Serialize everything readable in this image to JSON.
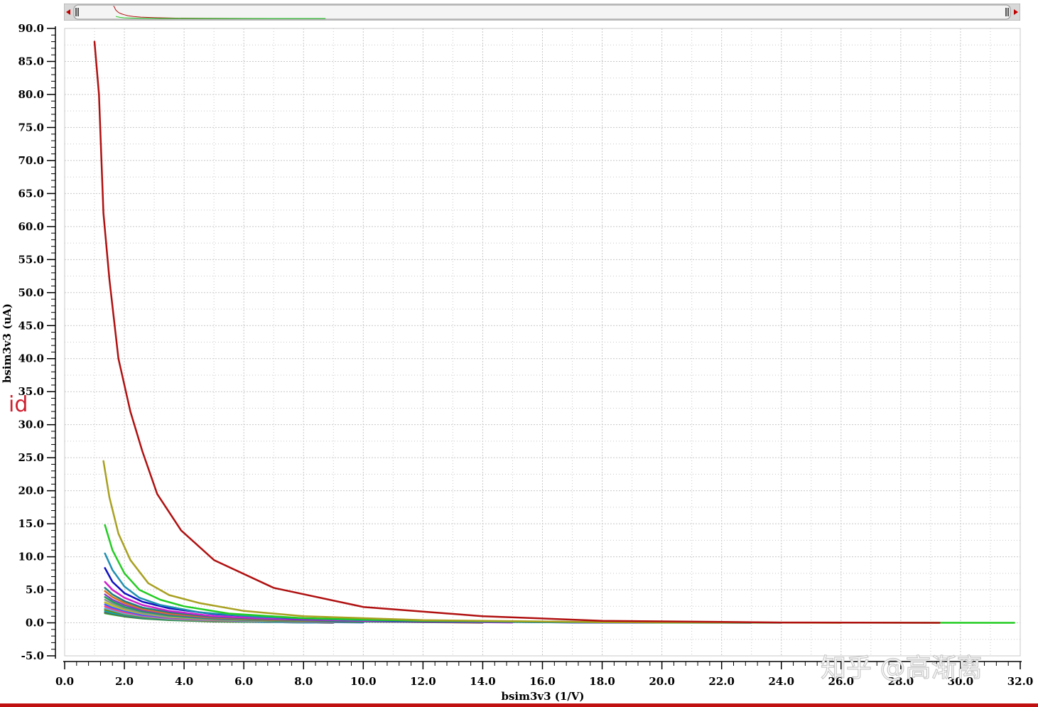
{
  "colors": {
    "background": "#ffffff",
    "grid": "#c8c8c8",
    "axis": "#000000",
    "trace_label": "#d02030",
    "bottom_border": "#c01010",
    "scrollbar_track": "#d8d8d8",
    "scrollbar_arrow": "#c00000"
  },
  "scrollbar": {
    "left_arrow_icon": "triangle-left-icon",
    "right_arrow_icon": "triangle-right-icon",
    "grip_icon": "grip-lines-icon"
  },
  "trace_label": "id",
  "watermark": "知乎 @高渐离",
  "chart_data": {
    "type": "line",
    "xlabel": "bsim3v3 (1/V)",
    "ylabel": "bsim3v3 (uA)",
    "xlim": [
      0,
      32
    ],
    "ylim": [
      -5,
      90
    ],
    "x_major_step": 2,
    "y_major_step": 5,
    "x_tick_labels": [
      "0.0",
      "2.0",
      "4.0",
      "6.0",
      "8.0",
      "10.0",
      "12.0",
      "14.0",
      "16.0",
      "18.0",
      "20.0",
      "22.0",
      "24.0",
      "26.0",
      "28.0",
      "30.0",
      "32.0"
    ],
    "y_tick_labels": [
      "-5.0",
      "0.0",
      "5.0",
      "10.0",
      "15.0",
      "20.0",
      "25.0",
      "30.0",
      "35.0",
      "40.0",
      "45.0",
      "50.0",
      "55.0",
      "60.0",
      "65.0",
      "70.0",
      "75.0",
      "80.0",
      "85.0",
      "90.0"
    ],
    "grid": true,
    "legend": "none",
    "series": [
      {
        "color": "#b01010",
        "x": [
          1.0,
          1.15,
          1.3,
          1.5,
          1.8,
          2.2,
          2.6,
          3.1,
          3.9,
          5.0,
          7.0,
          10.0,
          14.0,
          18.0,
          24.0,
          29.3
        ],
        "y": [
          88.0,
          80.0,
          62.0,
          52.0,
          40.0,
          32.0,
          26.0,
          19.5,
          14.0,
          9.5,
          5.3,
          2.4,
          1.0,
          0.3,
          0.05,
          0.0
        ]
      },
      {
        "color": "#a8a020",
        "x": [
          1.3,
          1.5,
          1.8,
          2.2,
          2.8,
          3.5,
          4.5,
          6.0,
          8.0,
          12.0,
          18.0,
          26.0
        ],
        "y": [
          24.5,
          19.0,
          13.5,
          9.5,
          6.0,
          4.2,
          3.0,
          1.8,
          1.0,
          0.4,
          0.1,
          0.0
        ]
      },
      {
        "color": "#22cc22",
        "x": [
          1.35,
          1.6,
          2.0,
          2.5,
          3.2,
          4.0,
          5.5,
          8.0,
          12.0,
          20.0,
          31.8
        ],
        "y": [
          14.8,
          11.0,
          7.5,
          5.0,
          3.5,
          2.5,
          1.4,
          0.7,
          0.3,
          0.05,
          0.0
        ]
      },
      {
        "color": "#2090b0",
        "x": [
          1.35,
          1.6,
          2.0,
          2.5,
          3.2,
          4.5,
          6.5,
          10.0,
          16.0,
          24.0
        ],
        "y": [
          10.5,
          8.0,
          5.5,
          3.8,
          2.7,
          1.6,
          0.9,
          0.4,
          0.1,
          0.0
        ]
      },
      {
        "color": "#1010c0",
        "x": [
          1.35,
          1.6,
          2.0,
          2.6,
          3.5,
          5.0,
          7.5,
          11.0,
          17.0,
          23.0
        ],
        "y": [
          8.3,
          6.2,
          4.5,
          3.2,
          2.2,
          1.3,
          0.7,
          0.3,
          0.05,
          0.0
        ]
      },
      {
        "color": "#cc20cc",
        "x": [
          1.35,
          1.6,
          2.0,
          2.6,
          3.5,
          5.0,
          7.0,
          10.0,
          15.0
        ],
        "y": [
          6.2,
          5.0,
          3.8,
          2.7,
          1.8,
          1.0,
          0.6,
          0.3,
          0.05
        ]
      },
      {
        "color": "#208080",
        "x": [
          1.35,
          1.6,
          2.0,
          2.6,
          3.5,
          5.0,
          7.0,
          10.0,
          14.0
        ],
        "y": [
          5.3,
          4.3,
          3.3,
          2.3,
          1.6,
          0.9,
          0.5,
          0.2,
          0.05
        ]
      },
      {
        "color": "#e07020",
        "x": [
          1.35,
          1.6,
          2.0,
          2.6,
          3.5,
          5.0,
          7.0,
          10.0,
          14.0
        ],
        "y": [
          4.8,
          3.9,
          3.0,
          2.1,
          1.4,
          0.8,
          0.4,
          0.2,
          0.0
        ]
      },
      {
        "color": "#8040c0",
        "x": [
          1.35,
          1.6,
          2.0,
          2.6,
          3.5,
          5.0,
          7.0,
          10.0
        ],
        "y": [
          4.3,
          3.5,
          2.7,
          1.9,
          1.3,
          0.7,
          0.4,
          0.15
        ]
      },
      {
        "color": "#20a060",
        "x": [
          1.35,
          1.6,
          2.0,
          2.6,
          3.5,
          5.0,
          7.0,
          10.0
        ],
        "y": [
          3.9,
          3.2,
          2.4,
          1.7,
          1.1,
          0.6,
          0.3,
          0.1
        ]
      },
      {
        "color": "#909090",
        "x": [
          1.35,
          1.6,
          2.0,
          2.6,
          3.5,
          5.0,
          7.0,
          10.0
        ],
        "y": [
          3.5,
          2.9,
          2.2,
          1.5,
          1.0,
          0.55,
          0.3,
          0.1
        ]
      },
      {
        "color": "#c0c020",
        "x": [
          1.35,
          1.6,
          2.0,
          2.6,
          3.5,
          5.0,
          7.0,
          10.0
        ],
        "y": [
          3.1,
          2.6,
          2.0,
          1.4,
          0.9,
          0.5,
          0.25,
          0.1
        ]
      },
      {
        "color": "#4060ff",
        "x": [
          1.35,
          1.6,
          2.0,
          2.6,
          3.5,
          5.0,
          7.0,
          10.0
        ],
        "y": [
          2.8,
          2.3,
          1.8,
          1.2,
          0.8,
          0.45,
          0.2,
          0.05
        ]
      },
      {
        "color": "#ff4080",
        "x": [
          1.35,
          1.6,
          2.0,
          2.6,
          3.5,
          5.0,
          7.0,
          9.0
        ],
        "y": [
          2.5,
          2.1,
          1.6,
          1.1,
          0.7,
          0.4,
          0.2,
          0.05
        ]
      },
      {
        "color": "#60b0e0",
        "x": [
          1.35,
          1.6,
          2.0,
          2.6,
          3.5,
          5.0,
          7.0,
          9.0
        ],
        "y": [
          2.2,
          1.9,
          1.4,
          1.0,
          0.6,
          0.35,
          0.15,
          0.05
        ]
      },
      {
        "color": "#808000",
        "x": [
          1.35,
          1.6,
          2.0,
          2.6,
          3.5,
          5.0,
          7.0,
          9.0
        ],
        "y": [
          2.0,
          1.7,
          1.3,
          0.9,
          0.55,
          0.3,
          0.15,
          0.05
        ]
      },
      {
        "color": "#00b0b0",
        "x": [
          1.35,
          1.6,
          2.0,
          2.6,
          3.5,
          5.0,
          7.0,
          9.0
        ],
        "y": [
          1.8,
          1.5,
          1.2,
          0.8,
          0.5,
          0.3,
          0.1,
          0.0
        ]
      },
      {
        "color": "#606060",
        "x": [
          1.35,
          1.6,
          2.0,
          2.6,
          3.5,
          5.0,
          7.0,
          9.0
        ],
        "y": [
          1.6,
          1.4,
          1.05,
          0.7,
          0.45,
          0.25,
          0.1,
          0.0
        ]
      },
      {
        "color": "#30a030",
        "x": [
          1.35,
          1.6,
          2.0,
          2.6,
          3.5,
          5.0,
          7.0,
          9.0
        ],
        "y": [
          1.45,
          1.25,
          0.95,
          0.65,
          0.4,
          0.2,
          0.1,
          0.0
        ]
      }
    ]
  }
}
